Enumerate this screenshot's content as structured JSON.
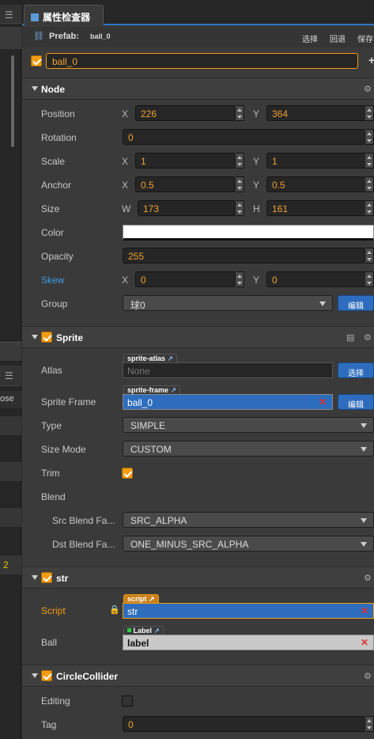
{
  "panel": {
    "title": "属性检查器",
    "prefab_label": "Prefab:",
    "prefab_name": "ball_0",
    "actions": [
      "选择",
      "回退",
      "保存"
    ]
  },
  "node_name": "ball_0",
  "node": {
    "title": "Node",
    "position": {
      "label": "Position",
      "x": "226",
      "y": "364"
    },
    "rotation": {
      "label": "Rotation",
      "value": "0"
    },
    "scale": {
      "label": "Scale",
      "x": "1",
      "y": "1"
    },
    "anchor": {
      "label": "Anchor",
      "x": "0.5",
      "y": "0.5"
    },
    "size": {
      "label": "Size",
      "w": "173",
      "h": "161"
    },
    "color": {
      "label": "Color",
      "value": "#ffffff"
    },
    "opacity": {
      "label": "Opacity",
      "value": "255"
    },
    "skew": {
      "label": "Skew",
      "x": "0",
      "y": "0"
    },
    "group": {
      "label": "Group",
      "value": "球0",
      "button": "编辑"
    },
    "axes": {
      "x": "X",
      "y": "Y",
      "w": "W",
      "h": "H"
    }
  },
  "sprite": {
    "title": "Sprite",
    "atlas": {
      "label": "Atlas",
      "tag": "sprite-atlas",
      "placeholder": "None",
      "button": "选择"
    },
    "frame": {
      "label": "Sprite Frame",
      "tag": "sprite-frame",
      "value": "ball_0",
      "button": "编辑"
    },
    "type": {
      "label": "Type",
      "value": "SIMPLE"
    },
    "size_mode": {
      "label": "Size Mode",
      "value": "CUSTOM"
    },
    "trim": {
      "label": "Trim",
      "checked": true
    },
    "blend": {
      "label": "Blend"
    },
    "src_blend": {
      "label": "Src Blend Fa...",
      "value": "SRC_ALPHA"
    },
    "dst_blend": {
      "label": "Dst Blend Fa...",
      "value": "ONE_MINUS_SRC_ALPHA"
    }
  },
  "str": {
    "title": "str",
    "script": {
      "label": "Script",
      "tag": "script",
      "value": "str"
    },
    "ball": {
      "label": "Ball",
      "tag": "Label",
      "value": "label"
    }
  },
  "collider": {
    "title": "CircleCollider",
    "editing": {
      "label": "Editing",
      "checked": false
    },
    "tag": {
      "label": "Tag",
      "value": "0"
    }
  },
  "left_panel": {
    "partial_label": "ose",
    "number": "2"
  },
  "colors": {
    "accent": "#2d76c6",
    "orange": "#f39c12",
    "number_text": "#f0a030"
  }
}
